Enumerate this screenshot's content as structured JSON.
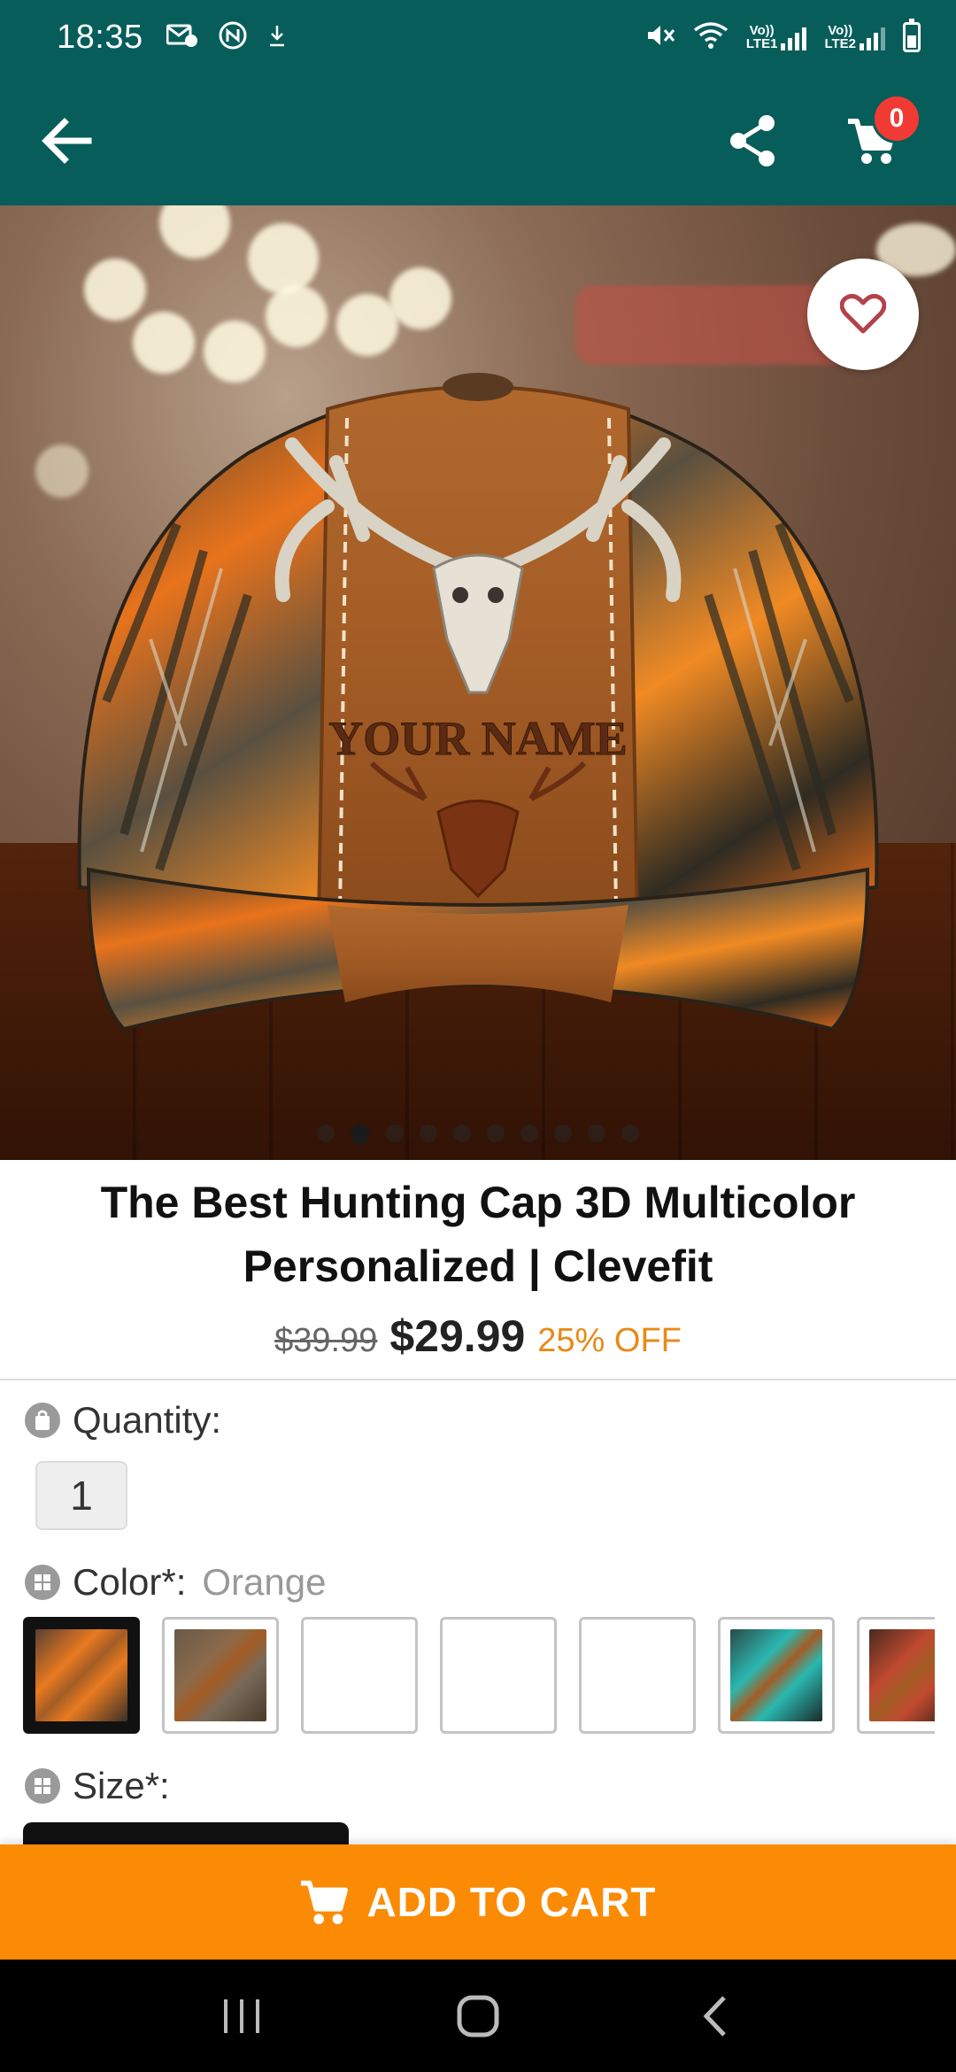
{
  "status_bar": {
    "time": "18:35",
    "sim1_label": "LTE1",
    "sim2_label": "LTE2",
    "vo_label": "Vo))"
  },
  "app_bar": {
    "cart_count": "0",
    "back_icon": "arrow-left-icon",
    "share_icon": "share-icon",
    "cart_icon": "shopping-cart-icon"
  },
  "hero": {
    "cap_text": "YOUR NAME",
    "image_count": 10,
    "active_index": 1,
    "favorite_icon": "heart-outline-icon"
  },
  "product": {
    "title": "The Best Hunting Cap 3D Multicolor Personalized | Clevefit",
    "old_price": "$39.99",
    "new_price": "$29.99",
    "discount": "25% OFF"
  },
  "options": {
    "quantity_label": "Quantity:",
    "quantity_value": "1",
    "color_label": "Color*:",
    "color_value": "Orange",
    "size_label": "Size*:"
  },
  "swatches": [
    {
      "name": "orange",
      "kind": "image",
      "selected": true
    },
    {
      "name": "brown",
      "kind": "image",
      "selected": false
    },
    {
      "name": "blank-1",
      "kind": "empty",
      "selected": false
    },
    {
      "name": "blank-2",
      "kind": "empty",
      "selected": false
    },
    {
      "name": "blank-3",
      "kind": "empty",
      "selected": false
    },
    {
      "name": "teal",
      "kind": "image",
      "selected": false
    },
    {
      "name": "red",
      "kind": "image",
      "selected": false
    }
  ],
  "cta": {
    "add_to_cart": "ADD TO CART"
  },
  "colors": {
    "primary": "#075d5a",
    "accent": "#fb8b05",
    "badge": "#f23a34",
    "discount": "#e88a17",
    "favorite": "#b4424a"
  }
}
